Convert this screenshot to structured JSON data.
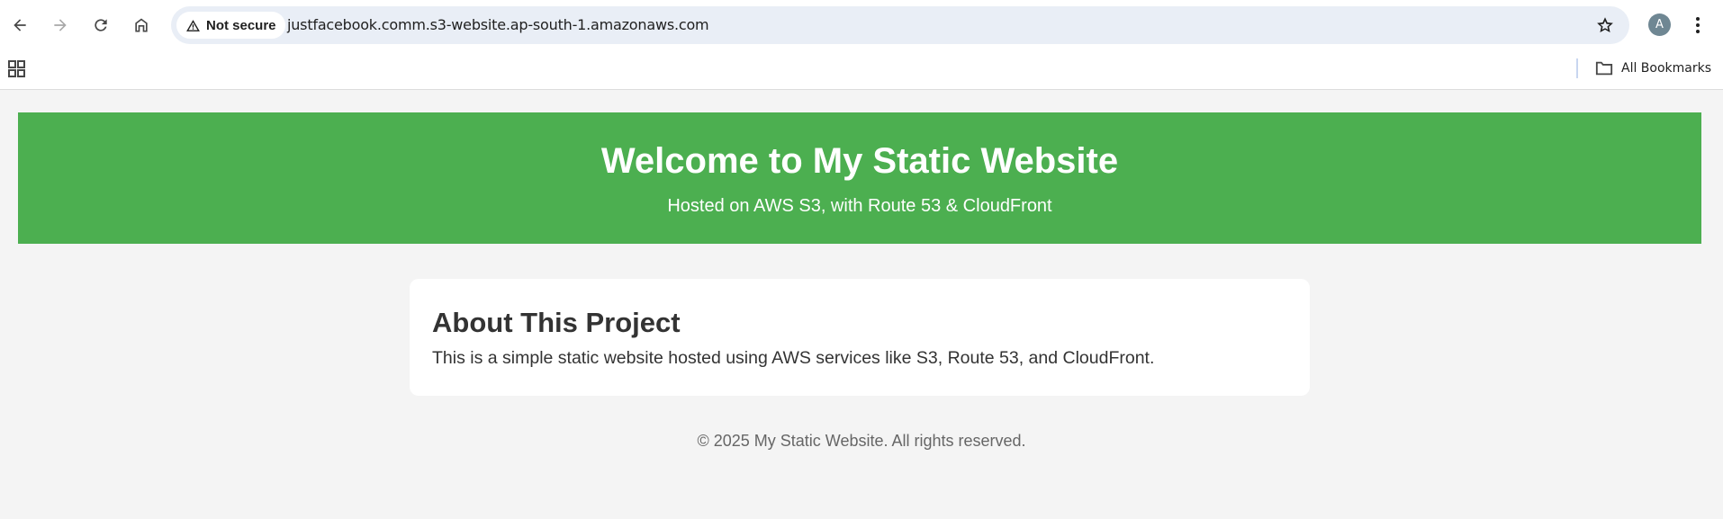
{
  "browser": {
    "security_label": "Not secure",
    "url": "justfacebook.comm.s3-website.ap-south-1.amazonaws.com",
    "profile_initial": "A",
    "bookmarks_label": "All Bookmarks",
    "icons": [
      "back-icon",
      "forward-icon",
      "reload-icon",
      "home-icon",
      "warning-icon",
      "star-icon",
      "kebab-menu-icon",
      "apps-grid-icon",
      "folder-icon"
    ]
  },
  "page": {
    "hero": {
      "title": "Welcome to My Static Website",
      "subtitle": "Hosted on AWS S3, with Route 53 & CloudFront"
    },
    "about": {
      "title": "About This Project",
      "text": "This is a simple static website hosted using AWS services like S3, Route 53, and CloudFront."
    },
    "footer": "© 2025 My Static Website. All rights reserved."
  },
  "colors": {
    "hero_background": "#4caf50",
    "page_background": "#f4f4f4",
    "omnibox_background": "#e9eef6",
    "avatar_background": "#6f8793"
  }
}
